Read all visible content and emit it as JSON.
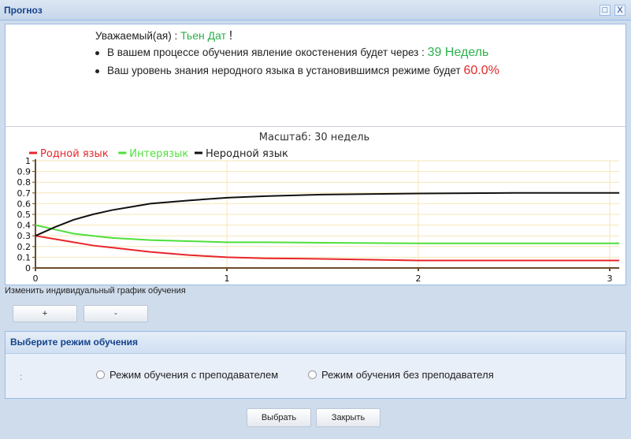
{
  "window": {
    "title": "Прогноз",
    "maximize_icon": "maximize-icon",
    "close_label": "X"
  },
  "info": {
    "greeting_label": "Уважаемый(ая) :",
    "user_name": "Тьен Дат",
    "exclamation": "!",
    "fossilization_text": "В вашем процессе обучения явление окостенения   будет через :",
    "fossilization_value": "39 Недель",
    "level_text": "Ваш уровень знания неродного языка в установившимся режиме будет",
    "level_value": "60.0%"
  },
  "chart_data": {
    "type": "line",
    "title": "Масштаб: 30 недель",
    "xlabel": "",
    "ylabel": "",
    "xlim": [
      0,
      3.05
    ],
    "ylim": [
      0,
      1
    ],
    "x_ticks": [
      "0",
      "1",
      "2",
      "3"
    ],
    "y_ticks": [
      "0",
      "0.1",
      "0.2",
      "0.3",
      "0.4",
      "0.5",
      "0.6",
      "0.7",
      "0.8",
      "0.9",
      "1"
    ],
    "grid": true,
    "legend_position": "top-left",
    "x": [
      0,
      0.1,
      0.2,
      0.3,
      0.4,
      0.5,
      0.6,
      0.8,
      1.0,
      1.2,
      1.5,
      2.0,
      2.5,
      3.0,
      3.05
    ],
    "series": [
      {
        "name": "Родной язык",
        "color": "#e8262b",
        "values": [
          0.3,
          0.27,
          0.24,
          0.21,
          0.19,
          0.17,
          0.15,
          0.12,
          0.1,
          0.09,
          0.085,
          0.07,
          0.07,
          0.07,
          0.07
        ]
      },
      {
        "name": "Интерязык",
        "color": "#4ee03a",
        "values": [
          0.4,
          0.36,
          0.32,
          0.3,
          0.28,
          0.27,
          0.26,
          0.25,
          0.24,
          0.24,
          0.235,
          0.23,
          0.23,
          0.23,
          0.23
        ]
      },
      {
        "name": "Неродной язык",
        "color": "#111111",
        "values": [
          0.3,
          0.38,
          0.45,
          0.5,
          0.54,
          0.57,
          0.6,
          0.63,
          0.655,
          0.67,
          0.685,
          0.695,
          0.7,
          0.7,
          0.7
        ]
      }
    ]
  },
  "schedule": {
    "label": "Изменить индивидуальный график обучения",
    "plus": "+",
    "minus": "-"
  },
  "mode": {
    "title": "Выберите режим обучения",
    "colon": ":",
    "options": [
      "Режим обучения с преподавателем",
      "Режим обучения без преподавателя"
    ]
  },
  "footer": {
    "select": "Выбрать",
    "close": "Закрыть"
  }
}
